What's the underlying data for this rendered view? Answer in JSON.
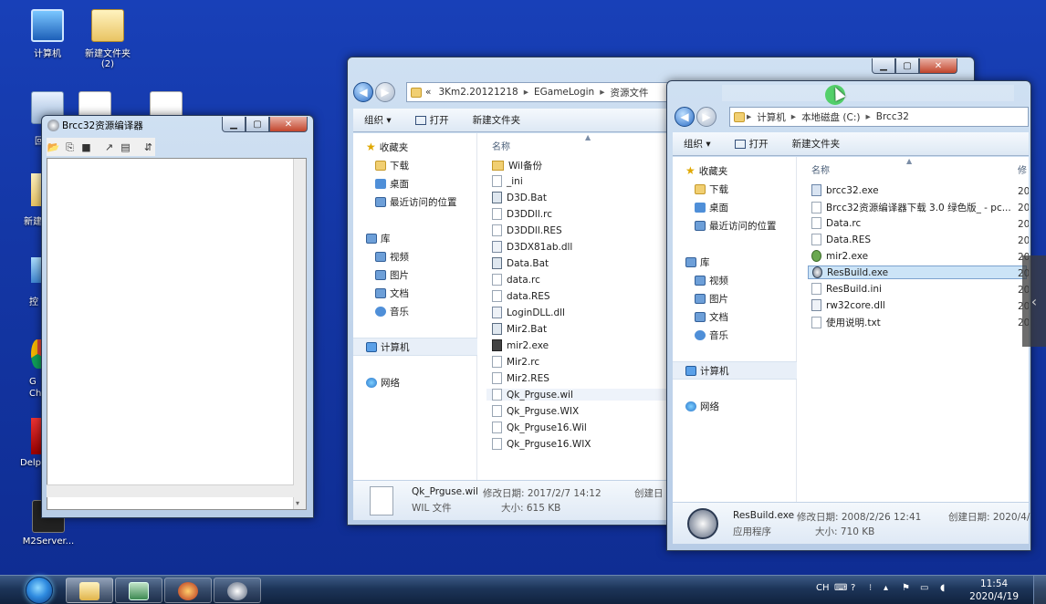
{
  "desktop": {
    "icons": [
      {
        "label": "计算机",
        "icon": "computer-icon"
      },
      {
        "label": "新建文件夹\n(2)",
        "icon": "folder-icon"
      },
      {
        "label": "回",
        "icon": "recycle-bin-icon"
      },
      {
        "label": "新建",
        "icon": "folder-icon"
      },
      {
        "label": "控",
        "icon": "control-panel-icon"
      },
      {
        "label": "G\nCh",
        "icon": "chrome-icon"
      },
      {
        "label": "Delp",
        "icon": "delphi-icon"
      },
      {
        "label": "M2Server...",
        "icon": "server-icon"
      }
    ]
  },
  "brcc_window": {
    "title": "Brcc32资源编译器",
    "toolbar_icons": [
      "open-icon",
      "copy-icon",
      "save-icon",
      "build-icon",
      "compile-icon",
      "run-icon"
    ]
  },
  "explorer1": {
    "breadcrumb": [
      "«",
      "3Km2.20121218",
      "EGameLogin",
      "资源文件"
    ],
    "toolbar": {
      "organize": "组织 ▾",
      "open": "打开",
      "new_folder": "新建文件夹"
    },
    "nav": {
      "favorites": "收藏夹",
      "downloads": "下载",
      "desktop": "桌面",
      "recent": "最近访问的位置",
      "libraries": "库",
      "videos": "视频",
      "pictures": "图片",
      "documents": "文档",
      "music": "音乐",
      "computer": "计算机",
      "network": "网络"
    },
    "column_name": "名称",
    "files": [
      {
        "name": "Wil备份",
        "type": "folder"
      },
      {
        "name": "_ini",
        "type": "file"
      },
      {
        "name": "D3D.Bat",
        "type": "bat"
      },
      {
        "name": "D3DDll.rc",
        "type": "file"
      },
      {
        "name": "D3DDll.RES",
        "type": "file"
      },
      {
        "name": "D3DX81ab.dll",
        "type": "dll"
      },
      {
        "name": "Data.Bat",
        "type": "bat"
      },
      {
        "name": "data.rc",
        "type": "file"
      },
      {
        "name": "data.RES",
        "type": "file"
      },
      {
        "name": "LoginDLL.dll",
        "type": "dll"
      },
      {
        "name": "Mir2.Bat",
        "type": "bat"
      },
      {
        "name": "mir2.exe",
        "type": "dark"
      },
      {
        "name": "Mir2.rc",
        "type": "file"
      },
      {
        "name": "Mir2.RES",
        "type": "file"
      },
      {
        "name": "Qk_Prguse.wil",
        "type": "file"
      },
      {
        "name": "Qk_Prguse.WIX",
        "type": "file"
      },
      {
        "name": "Qk_Prguse16.Wil",
        "type": "file"
      },
      {
        "name": "Qk_Prguse16.WIX",
        "type": "file"
      }
    ],
    "details": {
      "name": "Qk_Prguse.wil",
      "modified": "修改日期: 2017/2/7 14:12",
      "created": "创建日",
      "type": "WIL 文件",
      "size": "大小: 615 KB"
    }
  },
  "explorer2": {
    "breadcrumb": [
      "计算机",
      "本地磁盘 (C:)",
      "Brcc32"
    ],
    "toolbar": {
      "organize": "组织 ▾",
      "open": "打开",
      "new_folder": "新建文件夹"
    },
    "nav": {
      "favorites": "收藏夹",
      "downloads": "下载",
      "desktop": "桌面",
      "recent": "最近访问的位置",
      "libraries": "库",
      "videos": "视频",
      "pictures": "图片",
      "documents": "文档",
      "music": "音乐",
      "computer": "计算机",
      "network": "网络"
    },
    "column_name": "名称",
    "column_modified": "修",
    "files": [
      {
        "name": "brcc32.exe",
        "type": "exe",
        "date": "20"
      },
      {
        "name": "Brcc32资源编译器下载 3.0 绿色版_ - pc...",
        "type": "file",
        "date": "20"
      },
      {
        "name": "Data.rc",
        "type": "file",
        "date": "20"
      },
      {
        "name": "Data.RES",
        "type": "file",
        "date": "20"
      },
      {
        "name": "mir2.exe",
        "type": "mir",
        "date": "20"
      },
      {
        "name": "ResBuild.exe",
        "type": "gear",
        "date": "20"
      },
      {
        "name": "ResBuild.ini",
        "type": "file",
        "date": "20"
      },
      {
        "name": "rw32core.dll",
        "type": "dll",
        "date": "20"
      },
      {
        "name": "使用说明.txt",
        "type": "file",
        "date": "20"
      }
    ],
    "details": {
      "name": "ResBuild.exe",
      "modified": "修改日期: 2008/2/26 12:41",
      "created": "创建日期: 2020/4/",
      "type": "应用程序",
      "size": "大小: 710 KB"
    }
  },
  "taskbar": {
    "apps": [
      "explorer-icon",
      "monitor-icon",
      "spartan-helmet-icon",
      "resbuild-gear-icon"
    ],
    "tray": {
      "lang": "CH"
    },
    "clock": {
      "time": "11:54",
      "date": "2020/4/19"
    }
  }
}
